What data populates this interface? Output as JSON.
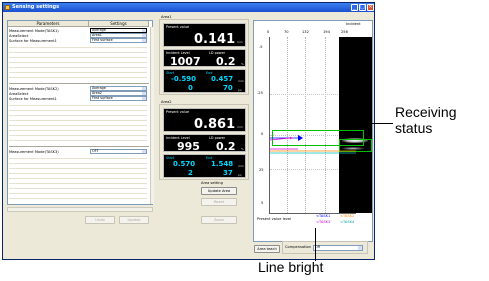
{
  "window": {
    "title": "Sensing settings"
  },
  "left": {
    "col_parameters": "Parameters",
    "col_settings": "Settings",
    "t1_label": "Measurement Mode(TASK1)",
    "t1_value": "Average",
    "t1_area_label": "AreaSelect",
    "t1_area_value": "Area1",
    "t1_surface_label": "Surface for Measurement1",
    "t1_surface_value": "First surface",
    "t2_label": "Measurement Mode(TASK2)",
    "t2_value": "Average",
    "t2_area_label": "AreaSelect",
    "t2_area_value": "Area2",
    "t2_surface_label": "Surface for Measurement1",
    "t2_surface_value": "First surface",
    "t3_label": "Measurement Mode(TASK3)",
    "t3_value": "OFF",
    "btn_undo": "Undo",
    "btn_update": "Update"
  },
  "area1": {
    "title": "Area1",
    "present_label": "Present value",
    "present_value": "0.141",
    "present_unit": "mm",
    "incident_label": "Incident Level",
    "incident_value": "1007",
    "ld_label": "LD power",
    "ld_value": "0.2",
    "ld_unit": "%",
    "start_label": "Start",
    "end_label": "End",
    "start_mm": "-0.590",
    "end_mm": "0.457",
    "mm_unit": "mm",
    "start_px": "0",
    "end_px": "70",
    "px_unit": "px"
  },
  "area2": {
    "title": "Area2",
    "present_label": "Present value",
    "present_value": "0.861",
    "present_unit": "mm",
    "incident_label": "Incident Level",
    "incident_value": "995",
    "ld_label": "LD power",
    "ld_value": "0.2",
    "ld_unit": "%",
    "start_label": "Start",
    "end_label": "End",
    "start_mm": "0.570",
    "end_mm": "1.548",
    "mm_unit": "mm",
    "start_px": "2",
    "end_px": "37",
    "px_unit": "px"
  },
  "area_setting": {
    "label": "Area setting",
    "update_area": "Update Area",
    "reset": "Reset",
    "zoom": "Zoom"
  },
  "graph": {
    "incident_header": "Incident",
    "x_ticks": [
      "0",
      "70",
      "132",
      "194",
      "256"
    ],
    "y_ticks": [
      "-5",
      "-25",
      "0",
      "25",
      "5"
    ],
    "present_value_level": "Present value level",
    "task1": "<TASK1",
    "task2": "<TASK2",
    "task3": "<TASK3",
    "task4": "<TASK4",
    "task1_color": "#0000ff",
    "task2_color": "#ff8c00",
    "task3_color": "#d000d0",
    "task4_color": "#00a0a0"
  },
  "bottom": {
    "area_teach": "Area teach",
    "compensation_label": "Compensation",
    "compensation_value": "Off"
  },
  "annotations": {
    "receiving_line1": "Receiving",
    "receiving_line2": "status",
    "line_bright": "Line bright"
  }
}
